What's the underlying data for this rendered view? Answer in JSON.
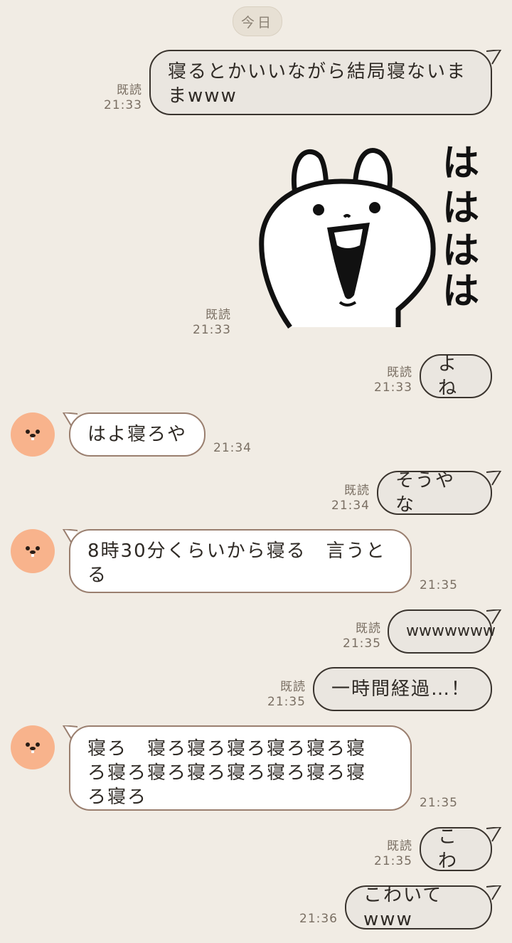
{
  "date_label": "今日",
  "messages": [
    {
      "text": "寝るとかいいながら結局寝ないままwww",
      "read": "既読",
      "time": "21:33"
    },
    {
      "sticker_text": "ははは は",
      "read": "既読",
      "time": "21:33"
    },
    {
      "text": "よね",
      "read": "既読",
      "time": "21:33"
    },
    {
      "text": "はよ寝ろや",
      "time": "21:34"
    },
    {
      "text": "そうやな",
      "read": "既読",
      "time": "21:34"
    },
    {
      "text": "8時30分くらいから寝る　言うとる",
      "time": "21:35"
    },
    {
      "text": "wwwwwww",
      "read": "既読",
      "time": "21:35"
    },
    {
      "text": "一時間経過…！",
      "read": "既読",
      "time": "21:35"
    },
    {
      "text": "寝ろ　寝ろ寝ろ寝ろ寝ろ寝ろ寝ろ寝ろ寝ろ寝ろ寝ろ寝ろ寝ろ寝ろ寝ろ",
      "time": "21:35"
    },
    {
      "text": "こわ",
      "read": "既読",
      "time": "21:35"
    },
    {
      "text": "こわいてwww",
      "time": "21:36"
    }
  ],
  "sticker": {
    "chars": [
      "は",
      "は",
      "は",
      "は"
    ],
    "icon": "laughing-rabbit-sticker"
  },
  "colors": {
    "background": "#f1ece4",
    "avatar": "#f8b38c"
  }
}
